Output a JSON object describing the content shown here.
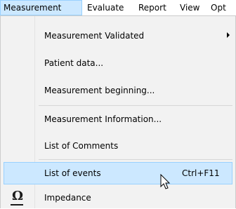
{
  "menubar": {
    "items": [
      {
        "label": "Measurement"
      },
      {
        "label": "Evaluate"
      },
      {
        "label": "Report"
      },
      {
        "label": "View"
      },
      {
        "label": "Opt"
      }
    ]
  },
  "menu": {
    "items": [
      {
        "label": "Measurement Validated",
        "has_submenu": true
      },
      {
        "label": "Patient data..."
      },
      {
        "label": "Measurement beginning..."
      },
      {
        "label": "Measurement Information..."
      },
      {
        "label": "List of Comments"
      },
      {
        "label": "List of events",
        "shortcut": "Ctrl+F11",
        "highlighted": true
      },
      {
        "label": "Impedance",
        "icon": "omega-icon"
      }
    ]
  },
  "colors": {
    "highlight_fill": "#cce8ff",
    "highlight_border": "#99d1ff",
    "menu_background": "#f2f2f2"
  }
}
